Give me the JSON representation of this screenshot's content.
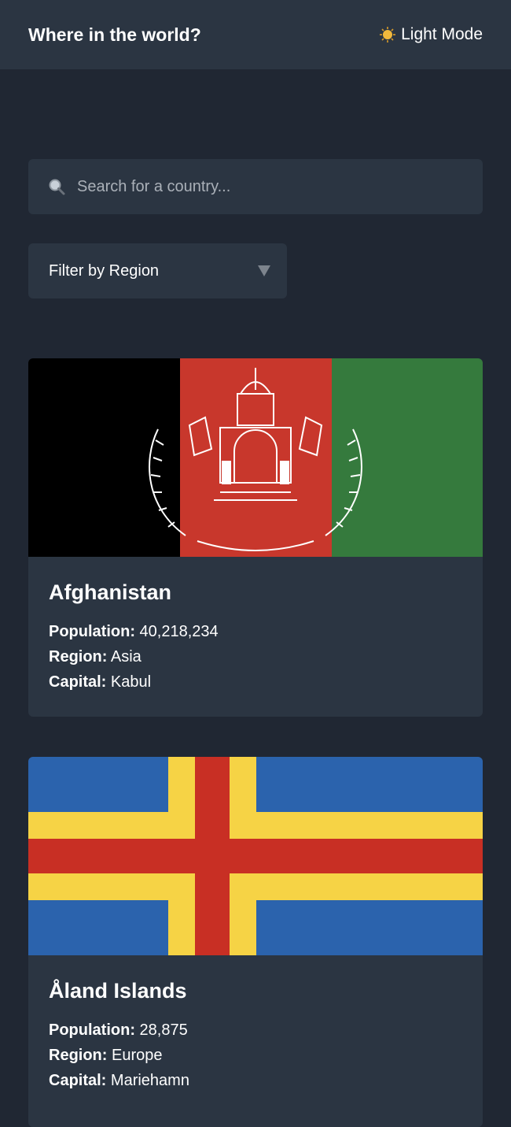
{
  "header": {
    "title": "Where in the world?",
    "mode_toggle_label": "Light Mode",
    "mode_icon": "sun-icon"
  },
  "search": {
    "placeholder": "Search for a country...",
    "value": "",
    "icon": "search-icon"
  },
  "filter": {
    "label": "Filter by Region",
    "icon": "caret-down-icon"
  },
  "labels": {
    "population": "Population:",
    "region": "Region:",
    "capital": "Capital:"
  },
  "countries": [
    {
      "name": "Afghanistan",
      "population": "40,218,234",
      "region": "Asia",
      "capital": "Kabul",
      "flag_colors": [
        "#000000",
        "#c8372c",
        "#357a3d"
      ]
    },
    {
      "name": "Åland Islands",
      "population": "28,875",
      "region": "Europe",
      "capital": "Mariehamn",
      "flag_colors": [
        "#2b63ad",
        "#f6d345",
        "#c82f24"
      ]
    }
  ]
}
